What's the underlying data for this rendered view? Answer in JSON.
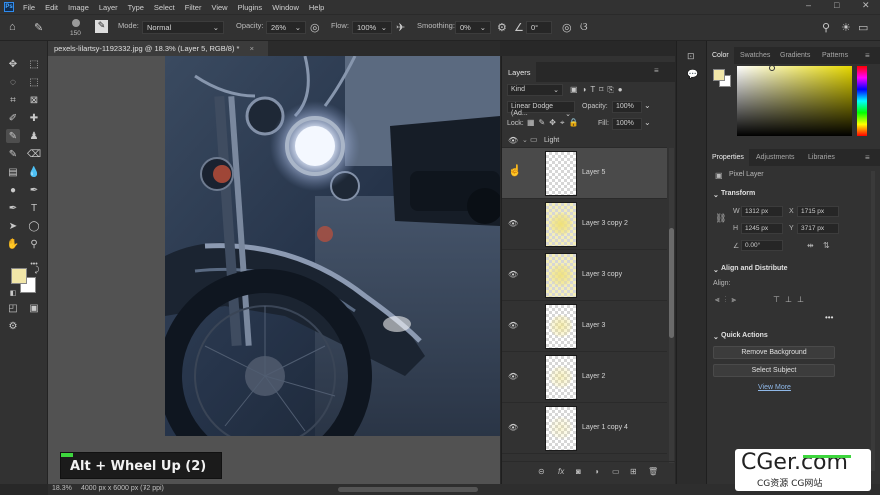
{
  "menubar": {
    "logo": "Ps",
    "items": [
      "File",
      "Edit",
      "Image",
      "Layer",
      "Type",
      "Select",
      "Filter",
      "View",
      "Plugins",
      "Window",
      "Help"
    ],
    "window_controls": [
      "–",
      "□",
      "✕"
    ]
  },
  "options_bar": {
    "brush_size": "150",
    "mode_label": "Mode:",
    "mode_value": "Normal",
    "opacity_label": "Opacity:",
    "opacity_value": "26%",
    "flow_label": "Flow:",
    "flow_value": "100%",
    "smoothing_label": "Smoothing:",
    "smoothing_value": "0%",
    "angle_value": "0°"
  },
  "document": {
    "tab_title": "pexels-lilartsy-1192332.jpg @ 18.3% (Layer 5, RGB/8) *",
    "tab_close": "×",
    "status_zoom": "18.3%",
    "status_info": "4000 px x 6000 px (72 ppi)"
  },
  "key_hint": {
    "text": "Alt + Wheel Up (2)"
  },
  "layers_panel": {
    "tab": "Layers",
    "kind_filter": "Kind",
    "blend_mode": "Linear Dodge (Ad...",
    "opacity_label": "Opacity:",
    "opacity_value": "100%",
    "lock_label": "Lock:",
    "fill_label": "Fill:",
    "fill_value": "100%",
    "group_name": "Light",
    "layers": [
      {
        "name": "Layer 5",
        "selected": true,
        "glow": 0.0
      },
      {
        "name": "Layer 3 copy 2",
        "selected": false,
        "glow": 1.0
      },
      {
        "name": "Layer 3 copy",
        "selected": false,
        "glow": 0.85
      },
      {
        "name": "Layer 3",
        "selected": false,
        "glow": 0.6
      },
      {
        "name": "Layer 2",
        "selected": false,
        "glow": 0.45
      },
      {
        "name": "Layer 1 copy 4",
        "selected": false,
        "glow": 0.3
      }
    ],
    "footer_icons": [
      "link-icon",
      "fx-icon",
      "mask-icon",
      "adjustment-icon",
      "group-icon",
      "new-layer-icon",
      "trash-icon"
    ]
  },
  "color_panel": {
    "tabs": [
      "Color",
      "Swatches",
      "Gradients",
      "Patterns"
    ],
    "hue_color": "#e6d800"
  },
  "properties_panel": {
    "tabs": [
      "Properties",
      "Adjustments",
      "Libraries"
    ],
    "layer_type": "Pixel Layer",
    "transform_title": "Transform",
    "w_label": "W",
    "w_value": "1312 px",
    "x_label": "X",
    "x_value": "1715 px",
    "h_label": "H",
    "h_value": "1245 px",
    "y_label": "Y",
    "y_value": "3717 px",
    "angle_value": "0.00°",
    "align_title": "Align and Distribute",
    "align_label": "Align:",
    "more": "•••",
    "quick_actions_title": "Quick Actions",
    "remove_bg": "Remove Background",
    "select_subject": "Select Subject",
    "view_more": "View More"
  },
  "watermark": {
    "line1": "CGer.com",
    "line2": "CG资源 CG网站"
  },
  "colors": {
    "foreground": "#f1e6a8",
    "background": "#ffffff",
    "accent": "#3dd63d"
  }
}
